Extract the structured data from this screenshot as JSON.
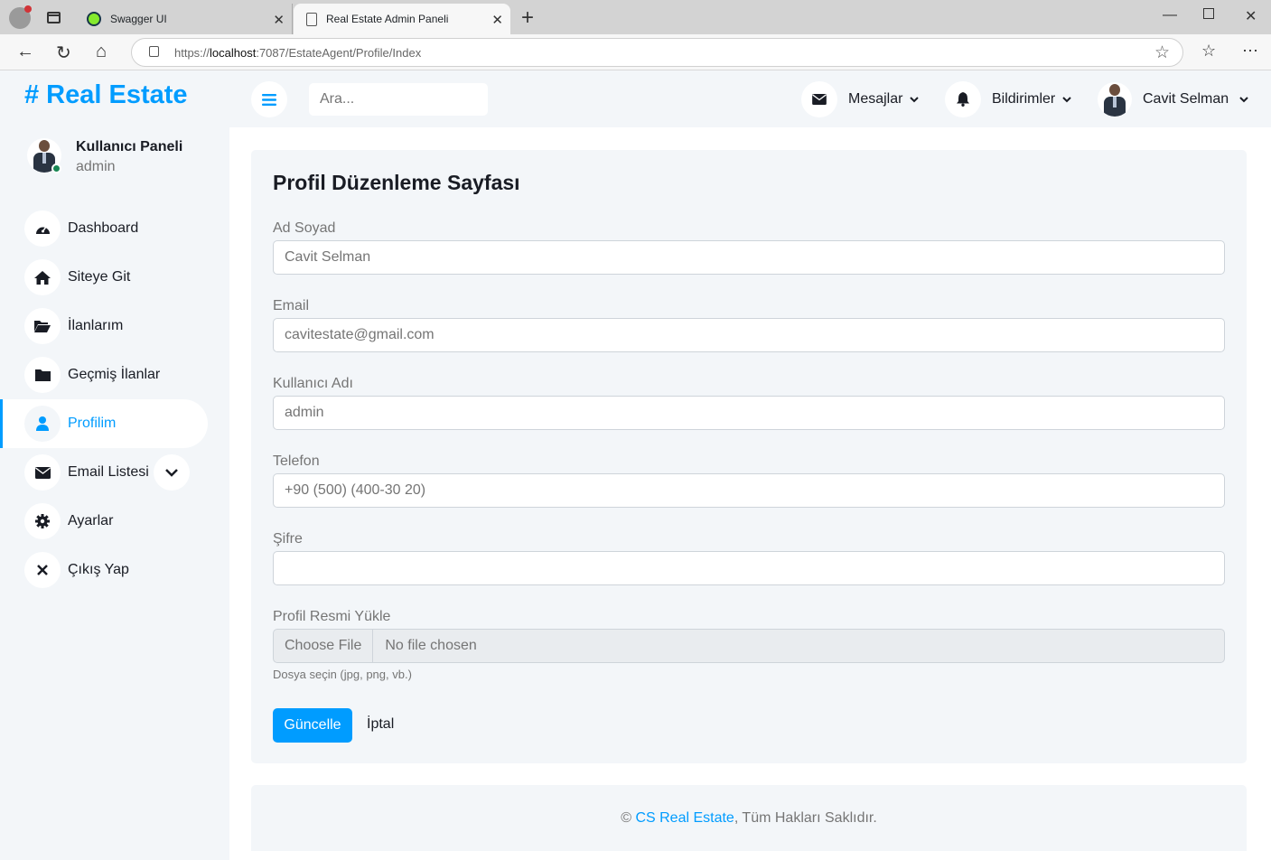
{
  "browser": {
    "tabs": [
      {
        "title": "Swagger UI",
        "active": false
      },
      {
        "title": "Real Estate Admin Paneli",
        "active": true
      }
    ],
    "url_prefix": "https://",
    "url_host": "localhost",
    "url_rest": ":7087/EstateAgent/Profile/Index"
  },
  "brand": "# Real Estate",
  "user_panel": {
    "title": "Kullanıcı Paneli",
    "role": "admin"
  },
  "menu": [
    {
      "label": "Dashboard",
      "icon": "gauge-icon"
    },
    {
      "label": "Siteye Git",
      "icon": "home-icon"
    },
    {
      "label": "İlanlarım",
      "icon": "folder-open-icon"
    },
    {
      "label": "Geçmiş İlanlar",
      "icon": "folder-icon"
    },
    {
      "label": "Profilim",
      "icon": "user-icon",
      "active": true
    },
    {
      "label": "Email Listesi",
      "icon": "envelope-icon",
      "has_dropdown": true
    },
    {
      "label": "Ayarlar",
      "icon": "gear-icon"
    },
    {
      "label": "Çıkış Yap",
      "icon": "close-icon"
    }
  ],
  "topnav": {
    "search_placeholder": "Ara...",
    "messages": "Mesajlar",
    "notifications": "Bildirimler",
    "user_name": "Cavit Selman"
  },
  "form": {
    "title": "Profil Düzenleme Sayfası",
    "fields": [
      {
        "label": "Ad Soyad",
        "value": "Cavit Selman"
      },
      {
        "label": "Email",
        "value": "cavitestate@gmail.com"
      },
      {
        "label": "Kullanıcı Adı",
        "value": "admin"
      },
      {
        "label": "Telefon",
        "value": "+90 (500) (400-30 20)"
      },
      {
        "label": "Şifre",
        "value": ""
      }
    ],
    "file": {
      "label": "Profil Resmi Yükle",
      "button": "Choose File",
      "status": "No file chosen",
      "help": "Dosya seçin (jpg, png, vb.)"
    },
    "submit": "Güncelle",
    "cancel": "İptal"
  },
  "footer": {
    "prefix": "©",
    "link": "CS Real Estate",
    "suffix": ", Tüm Hakları Saklıdır."
  },
  "colors": {
    "primary": "#009cff",
    "background": "#f3f6f9",
    "online": "#198754"
  }
}
